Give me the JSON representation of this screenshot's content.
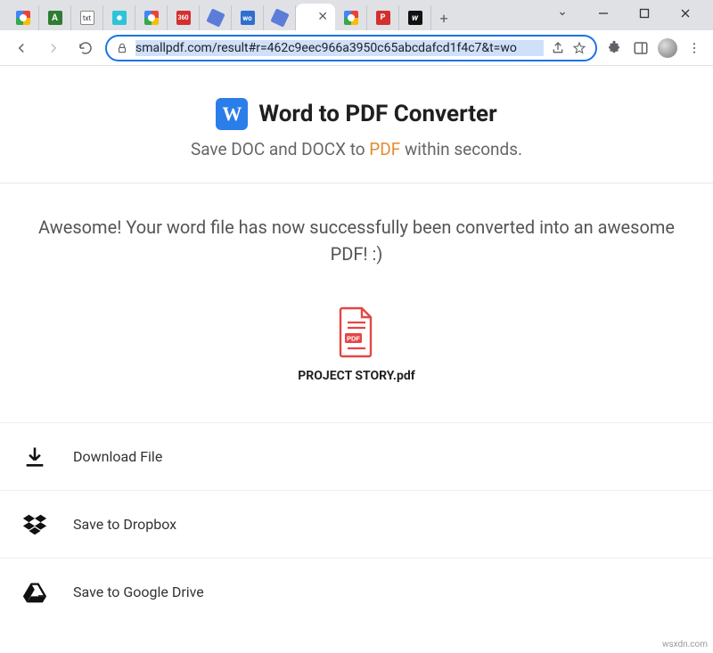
{
  "window": {
    "url": "smallpdf.com/result#r=462c9eec966a3950c65abcdafcd1f4c7&t=wo"
  },
  "tabs": {
    "items": [
      {
        "id": "g1"
      },
      {
        "id": "green-a",
        "text": "A"
      },
      {
        "id": "txt",
        "text": "txt"
      },
      {
        "id": "cyan"
      },
      {
        "id": "g2"
      },
      {
        "id": "360",
        "text": "360"
      },
      {
        "id": "pill1"
      },
      {
        "id": "wo",
        "text": "wo"
      },
      {
        "id": "pill2"
      },
      {
        "id": "active"
      },
      {
        "id": "g3"
      },
      {
        "id": "p",
        "text": "P"
      },
      {
        "id": "w",
        "text": "w"
      }
    ]
  },
  "hero": {
    "badge_letter": "W",
    "title": "Word to PDF Converter",
    "sub_pre": "Save DOC and DOCX to ",
    "sub_accent": "PDF",
    "sub_post": " within seconds."
  },
  "message": "Awesome! Your word file has now successfully been converted into an awesome PDF! :)",
  "file": {
    "name": "PROJECT STORY.pdf",
    "badge": "PDF"
  },
  "actions": {
    "download": "Download File",
    "dropbox": "Save to Dropbox",
    "gdrive": "Save to Google Drive"
  },
  "watermark": "wsxdn.com"
}
